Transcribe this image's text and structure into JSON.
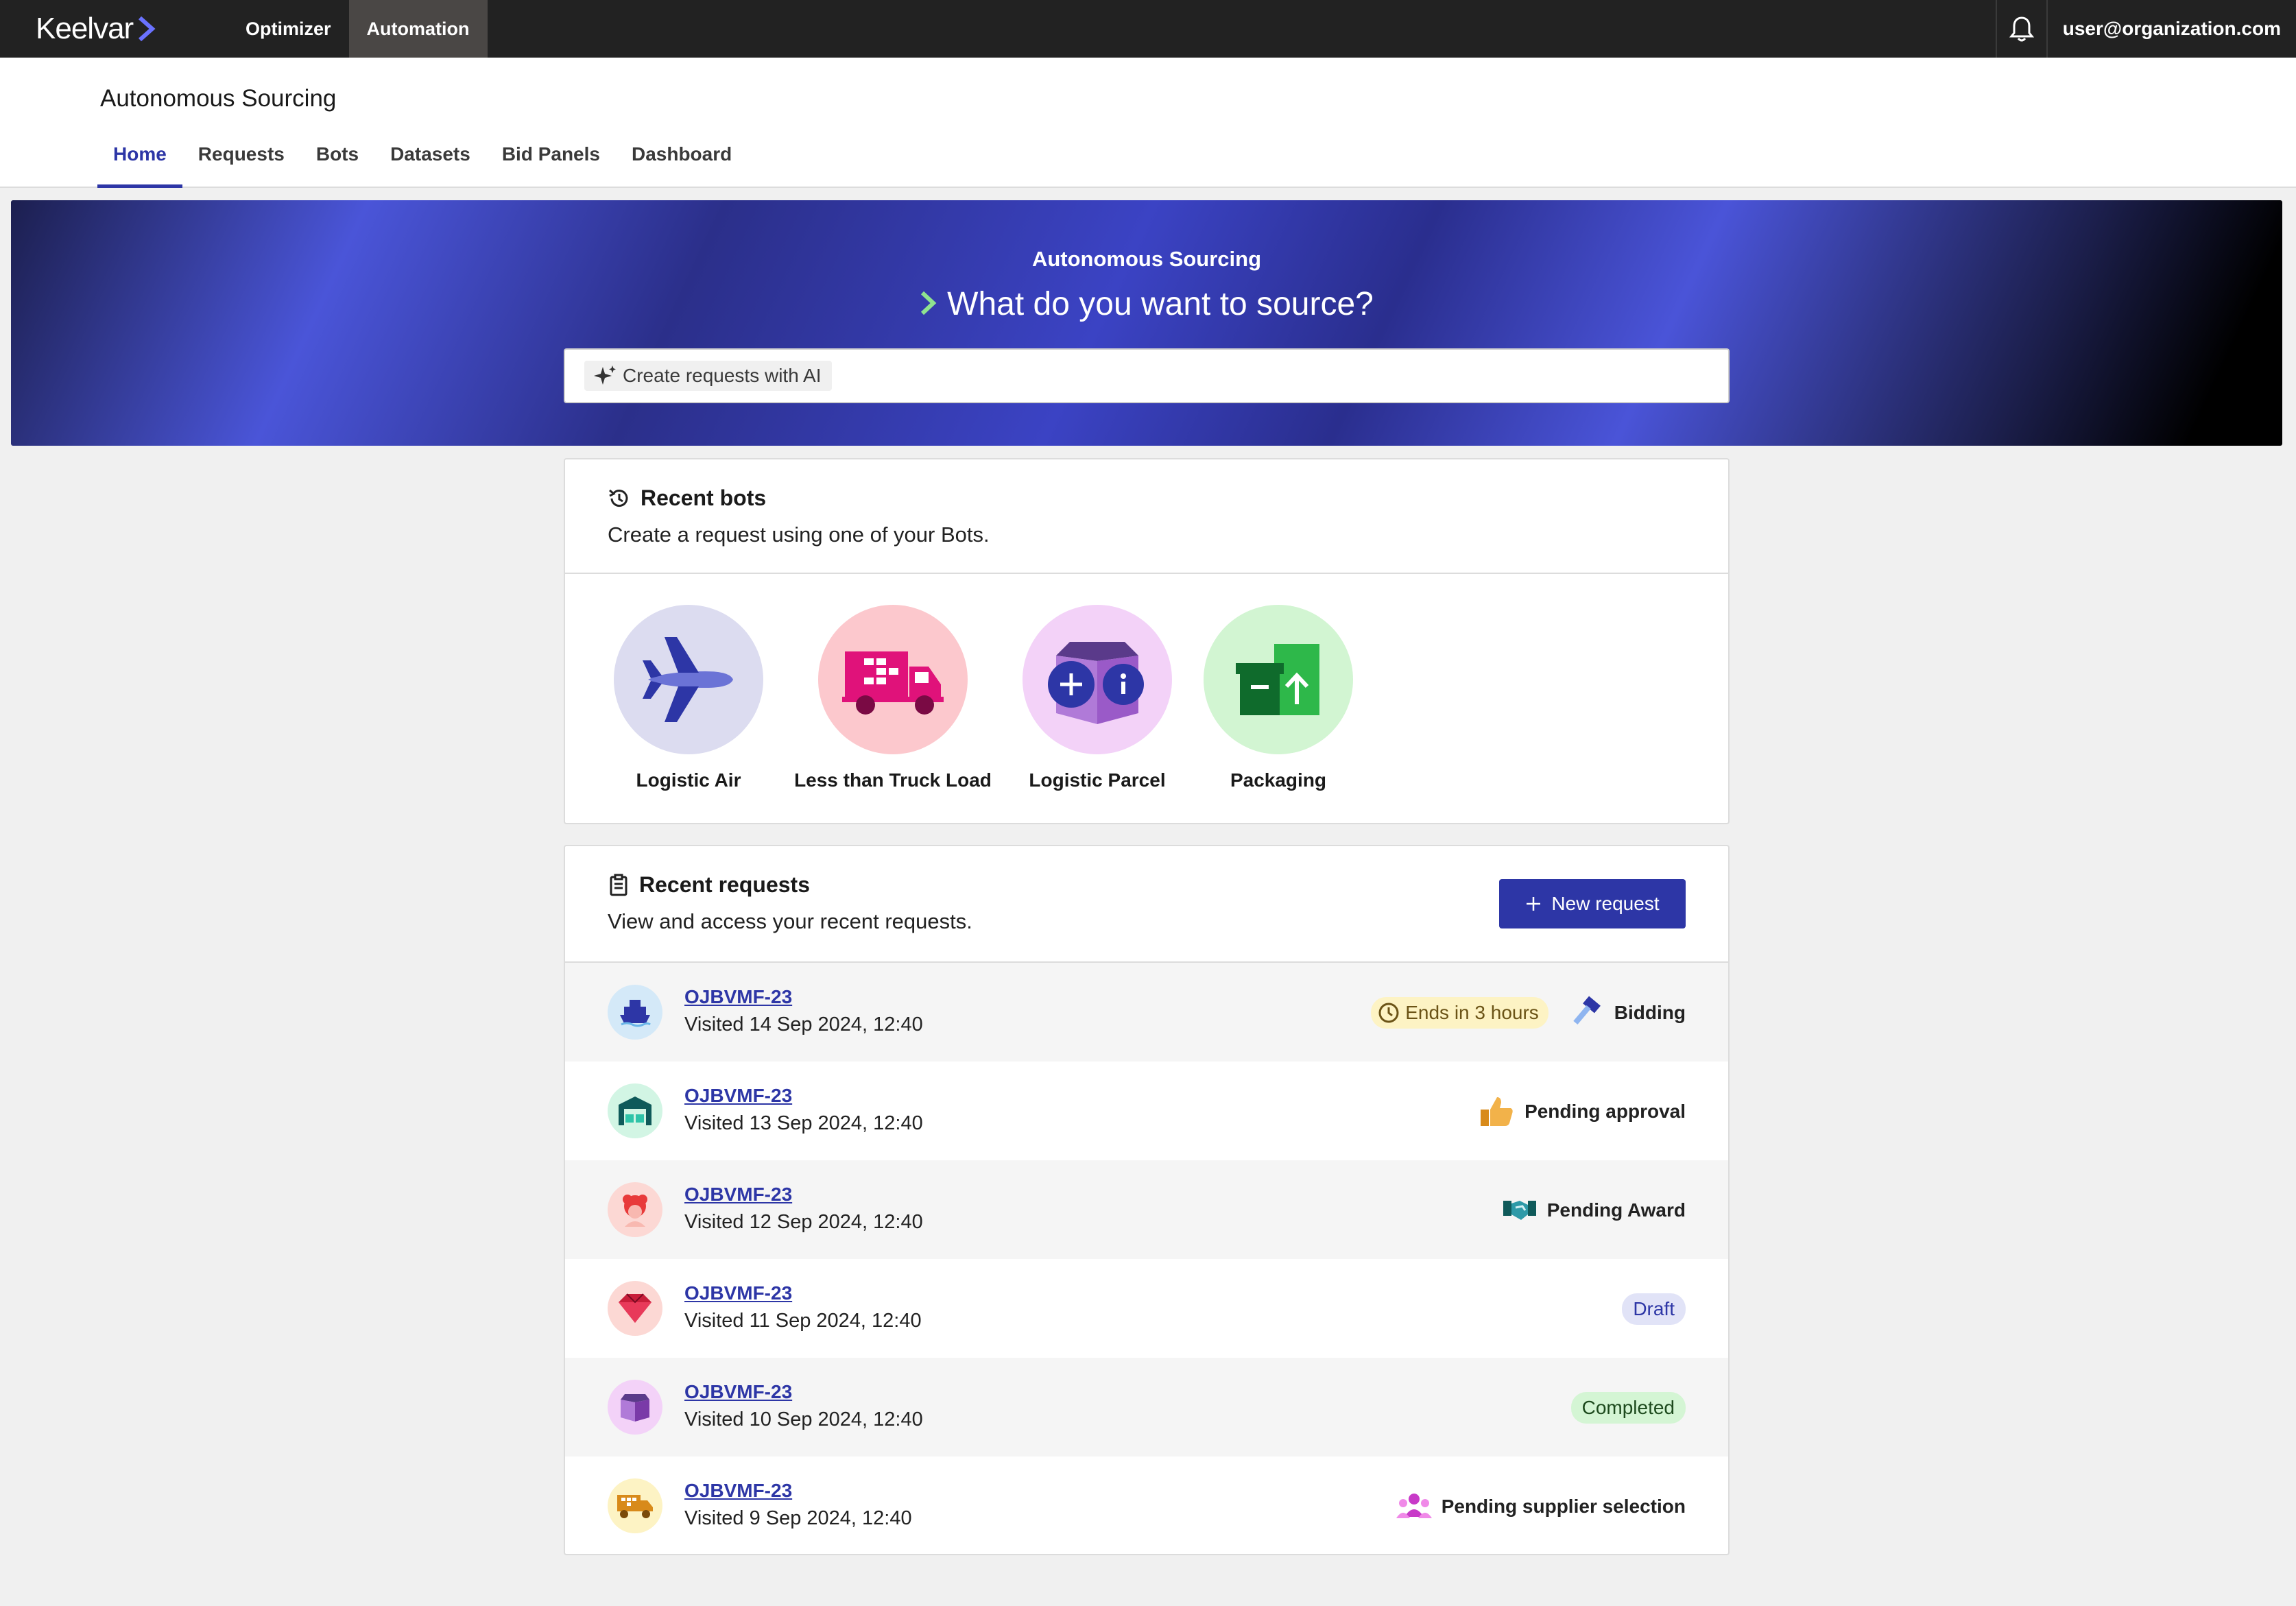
{
  "topbar": {
    "brand": "Keelvar",
    "nav": [
      "Optimizer",
      "Automation"
    ],
    "active_nav": "Automation",
    "user_email": "user@organization.com"
  },
  "subheader": {
    "title": "Autonomous Sourcing",
    "tabs": [
      "Home",
      "Requests",
      "Bots",
      "Datasets",
      "Bid Panels",
      "Dashboard"
    ],
    "active_tab": "Home"
  },
  "hero": {
    "eyebrow": "Autonomous Sourcing",
    "headline": "What do you want to source?",
    "ai_chip": "Create requests with AI"
  },
  "recent_bots": {
    "title": "Recent bots",
    "subtitle": "Create a request using one of your Bots.",
    "bots": [
      {
        "label": "Logistic Air",
        "icon": "airplane-icon",
        "bg": "#dcdcf0"
      },
      {
        "label": "Less than Truck Load",
        "icon": "truck-icon",
        "bg": "#fcc8cd"
      },
      {
        "label": "Logistic Parcel",
        "icon": "parcel-icon",
        "bg": "#f3d2f8"
      },
      {
        "label": "Packaging",
        "icon": "packaging-icon",
        "bg": "#d2f5d2"
      }
    ]
  },
  "recent_requests": {
    "title": "Recent requests",
    "subtitle": "View and access your recent requests.",
    "new_button": "New request",
    "rows": [
      {
        "id": "OJBVMF-23",
        "visited": "Visited 14 Sep 2024, 12:40",
        "avatar": "ship-icon",
        "avatar_bg": "#d4e9f8",
        "time_chip": "Ends in 3 hours",
        "status": "Bidding",
        "status_icon": "gavel-icon",
        "style": "icon"
      },
      {
        "id": "OJBVMF-23",
        "visited": "Visited 13 Sep 2024, 12:40",
        "avatar": "warehouse-icon",
        "avatar_bg": "#d2f5e4",
        "status": "Pending approval",
        "status_icon": "thumbs-up-icon",
        "style": "icon"
      },
      {
        "id": "OJBVMF-23",
        "visited": "Visited 12 Sep 2024, 12:40",
        "avatar": "person-icon",
        "avatar_bg": "#fcd8d4",
        "status": "Pending Award",
        "status_icon": "handshake-icon",
        "style": "icon"
      },
      {
        "id": "OJBVMF-23",
        "visited": "Visited 11 Sep 2024, 12:40",
        "avatar": "gem-icon",
        "avatar_bg": "#fcd8d4",
        "status": "Draft",
        "style": "pill-draft"
      },
      {
        "id": "OJBVMF-23",
        "visited": "Visited 10 Sep 2024, 12:40",
        "avatar": "box-icon",
        "avatar_bg": "#f3d2f8",
        "status": "Completed",
        "style": "pill-completed"
      },
      {
        "id": "OJBVMF-23",
        "visited": "Visited 9 Sep 2024, 12:40",
        "avatar": "delivery-truck-icon",
        "avatar_bg": "#fdf3c4",
        "status": "Pending supplier selection",
        "status_icon": "people-icon",
        "style": "icon"
      }
    ]
  }
}
